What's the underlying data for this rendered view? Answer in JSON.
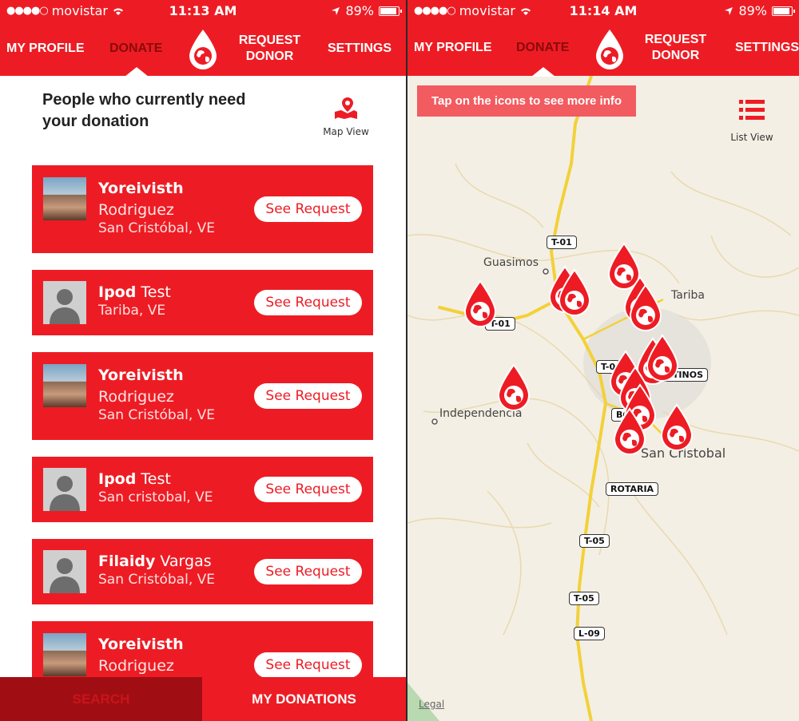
{
  "left": {
    "status": {
      "carrier": "movistar",
      "time": "11:13 AM",
      "battery": "89%"
    },
    "nav": {
      "profile": "MY PROFILE",
      "donate": "DONATE",
      "request": "REQUEST DONOR",
      "settings": "SETTINGS"
    },
    "headline": "People who currently need your donation",
    "map_view_label": "Map View",
    "cards": [
      {
        "first": "Yoreivisth",
        "last": "Rodriguez",
        "location": "San Cristóbal, VE",
        "button": "See Request"
      },
      {
        "first": "Ipod",
        "last": "Test",
        "location": "Tariba, VE",
        "button": "See Request"
      },
      {
        "first": "Yoreivisth",
        "last": "Rodriguez",
        "location": "San Cristóbal, VE",
        "button": "See Request"
      },
      {
        "first": "Ipod",
        "last": "Test",
        "location": "San cristobal, VE",
        "button": "See Request"
      },
      {
        "first": "Filaidy",
        "last": "Vargas",
        "location": "San Cristóbal, VE",
        "button": "See Request"
      },
      {
        "first": "Yoreivisth",
        "last": "Rodriguez",
        "location": "",
        "button": "See Request"
      }
    ],
    "bottom": {
      "search": "SEARCH",
      "donations": "MY DONATIONS"
    }
  },
  "right": {
    "status": {
      "carrier": "movistar",
      "time": "11:14 AM",
      "battery": "89%"
    },
    "nav": {
      "profile": "MY PROFILE",
      "donate": "DONATE",
      "request": "REQUEST DONOR",
      "settings": "SETTINGS"
    },
    "tooltip": "Tap on the icons to see more info",
    "list_view_label": "List View",
    "map": {
      "places": [
        "Guasimos",
        "Tariba",
        "Independencia",
        "San Cristobal"
      ],
      "roads": [
        "T-01",
        "T-01",
        "T-0",
        "STINOS",
        "BO",
        "ROTARIA",
        "T-05",
        "T-05",
        "L-09"
      ],
      "legal": "Legal"
    }
  },
  "colors": {
    "primary": "#ed1c24",
    "dark_red": "#a00e13",
    "map_bg": "#f4efe4",
    "road": "#f2d13a"
  }
}
